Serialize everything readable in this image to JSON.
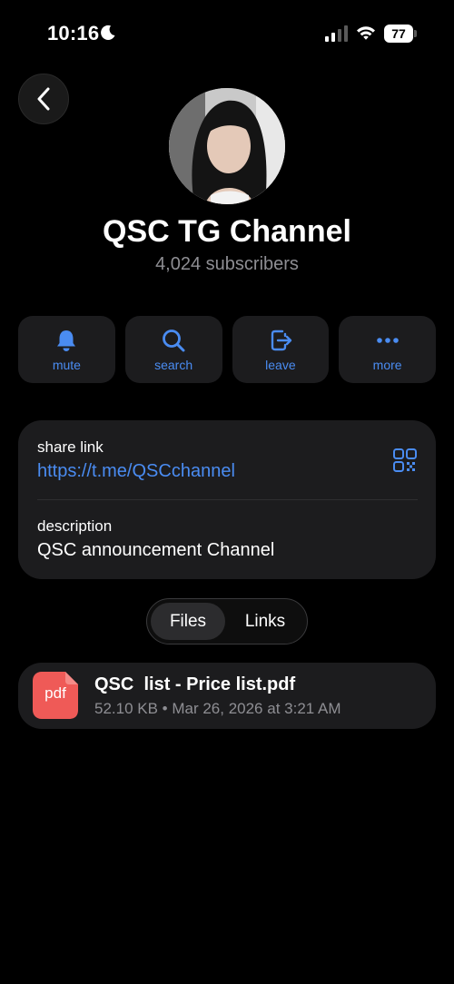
{
  "status_bar": {
    "time": "10:16",
    "battery": "77"
  },
  "channel": {
    "title": "QSC TG Channel",
    "subscribers": "4,024 subscribers"
  },
  "actions": [
    {
      "label": "mute",
      "icon": "bell-icon"
    },
    {
      "label": "search",
      "icon": "search-icon"
    },
    {
      "label": "leave",
      "icon": "leave-icon"
    },
    {
      "label": "more",
      "icon": "more-icon"
    }
  ],
  "info": {
    "share_label": "share link",
    "share_url": "https://t.me/QSCchannel",
    "description_label": "description",
    "description": "QSC announcement Channel"
  },
  "tabs": {
    "files": "Files",
    "links": "Links",
    "selected": "Files"
  },
  "files": [
    {
      "icon_text": "pdf",
      "name": "QSC  list - Price list.pdf",
      "meta": "52.10 KB • Mar 26, 2026 at 3:21 AM"
    }
  ],
  "colors": {
    "accent": "#4a8cf2",
    "card": "#1c1c1e",
    "pdf": "#ef5a57"
  }
}
